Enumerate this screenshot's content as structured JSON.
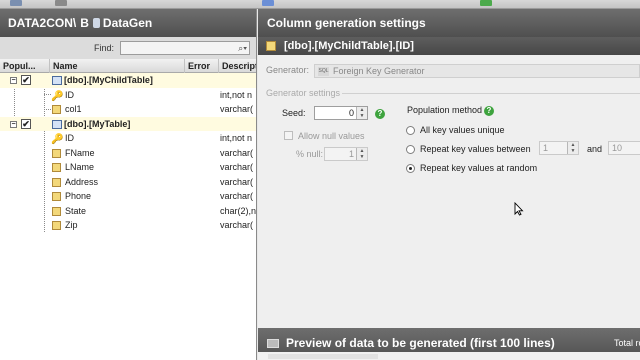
{
  "left_panel": {
    "path": [
      "DATA2CON\\",
      "B",
      "DataGen"
    ],
    "find_label": "Find:",
    "find_value": "",
    "columns": [
      "Popul...",
      "Name",
      "Error",
      "Descript"
    ],
    "tree": [
      {
        "kind": "table",
        "name": "[dbo].[MyChildTable]",
        "checked": true,
        "expanded": true
      },
      {
        "kind": "column",
        "icon": "key-icon",
        "name": "ID",
        "type": "int,not n"
      },
      {
        "kind": "column",
        "icon": "column-icon",
        "name": "col1",
        "type": "varchar("
      },
      {
        "kind": "table",
        "name": "[dbo].[MyTable]",
        "checked": true,
        "expanded": true
      },
      {
        "kind": "column",
        "icon": "key-icon",
        "name": "ID",
        "type": "int,not n"
      },
      {
        "kind": "column",
        "icon": "column-icon",
        "name": "FName",
        "type": "varchar("
      },
      {
        "kind": "column",
        "icon": "column-icon",
        "name": "LName",
        "type": "varchar("
      },
      {
        "kind": "column",
        "icon": "column-icon",
        "name": "Address",
        "type": "varchar("
      },
      {
        "kind": "column",
        "icon": "column-icon",
        "name": "Phone",
        "type": "varchar("
      },
      {
        "kind": "column",
        "icon": "column-icon",
        "name": "State",
        "type": "char(2),n"
      },
      {
        "kind": "column",
        "icon": "column-icon",
        "name": "Zip",
        "type": "varchar("
      }
    ]
  },
  "right_panel": {
    "title": "Column generation settings",
    "column_path": "[dbo].[MyChildTable].[ID]",
    "generator_label": "Generator:",
    "generator_value": "Foreign Key Generator",
    "generator_icon_text": "SQL",
    "generator_settings_label": "Generator settings",
    "seed_label": "Seed:",
    "seed_value": "0",
    "allow_null_label": "Allow null values",
    "pct_null_label": "% null:",
    "pct_null_value": "1",
    "population_method_label": "Population method",
    "options": {
      "unique": "All key values unique",
      "between": "Repeat key values between",
      "random": "Repeat key values at random"
    },
    "selected_option": "random",
    "between_min": "1",
    "and_label": "and",
    "between_max": "10"
  },
  "preview": {
    "title": "Preview of data to be generated (first 100 lines)",
    "total_rows_label": "Total rows to"
  }
}
